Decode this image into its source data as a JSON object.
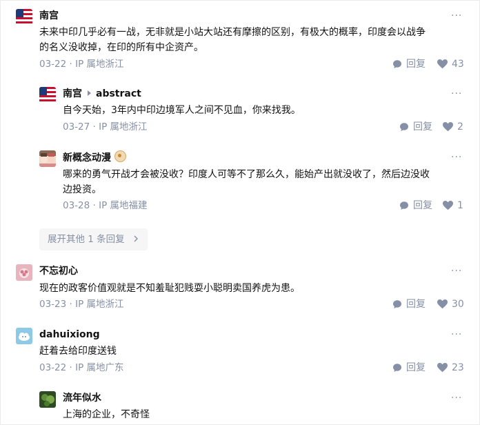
{
  "comments": [
    {
      "user": "南宫",
      "text_lines": [
        "未来中印几乎必有一战，无非就是小站大站还有摩擦的区别，有极大的概率，印度会以战争",
        "的名义没收掉，在印的所有中企资产。"
      ],
      "meta": "03-22 · IP 属地浙江",
      "reply_label": "回复",
      "likes": "43",
      "replies": [
        {
          "user": "南宫",
          "reply_to": "abstract",
          "text_lines": [
            "自今天始，3年内中印边境军人之间不见血，你来找我。"
          ],
          "meta": "03-27 · IP 属地浙江",
          "reply_label": "回复",
          "likes": "2"
        },
        {
          "user": "新概念动漫",
          "text_lines": [
            "哪来的勇气开战才会被没收？印度人可等不了那么久，能始产出就没收了，然后边没收",
            "边投资。"
          ],
          "meta": "03-28 · IP 属地福建",
          "reply_label": "回复",
          "likes": "1"
        }
      ],
      "expand_label": "展开其他 1 条回复"
    },
    {
      "user": "不忘初心",
      "text_lines": [
        "现在的政客价值观就是不知羞耻犯贱耍小聪明卖国养虎为患。"
      ],
      "meta": "03-23 · IP 属地浙江",
      "reply_label": "回复",
      "likes": "30"
    },
    {
      "user": "dahuixiong",
      "text_lines": [
        "赶着去给印度送钱"
      ],
      "meta": "03-22 · IP 属地广东",
      "reply_label": "回复",
      "likes": "23",
      "replies": [
        {
          "user": "流年似水",
          "text_lines": [
            "上海的企业，不奇怪"
          ]
        }
      ]
    }
  ],
  "more_symbol": "···",
  "colors": {
    "meta": "#8590a6",
    "text": "#121212",
    "expand_bg": "#f6f6f6"
  },
  "icons": [
    "us-flag-avatar-icon",
    "anime-avatar-icon",
    "pink-flower-avatar-icon",
    "cloud-avatar-icon",
    "green-plant-avatar-icon",
    "comment-bubble-icon",
    "heart-icon",
    "more-dots-icon",
    "chevron-right-icon",
    "medal-badge-icon"
  ]
}
